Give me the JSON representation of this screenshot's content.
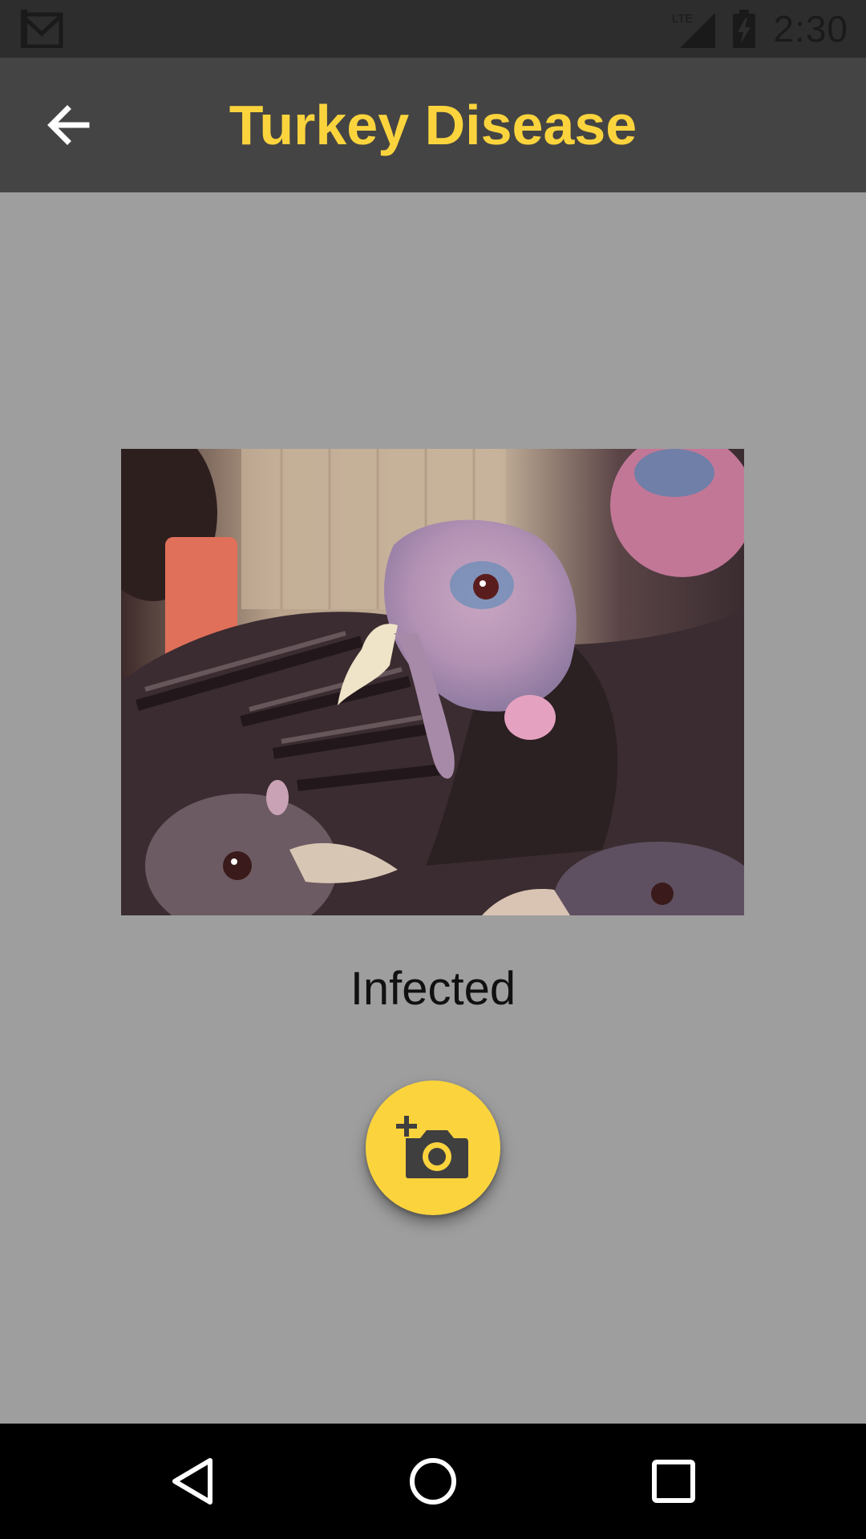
{
  "status_bar": {
    "time": "2:30",
    "notification_icon": "gmail-icon",
    "network_label": "LTE",
    "signal_icon": "cellular-signal-icon",
    "battery_icon": "battery-charging-icon"
  },
  "app_bar": {
    "title": "Turkey Disease",
    "back_icon": "arrow-back-icon",
    "background_color": "#444444",
    "title_color": "#fbd43d"
  },
  "main": {
    "image_subject": "turkey-head-photo",
    "result_label": "Infected",
    "fab_icon": "add-a-photo-icon",
    "fab_color": "#fbd43d",
    "background_color": "#9e9e9e"
  },
  "nav_bar": {
    "back_icon": "nav-back-triangle-icon",
    "home_icon": "nav-home-circle-icon",
    "recents_icon": "nav-recents-square-icon"
  }
}
